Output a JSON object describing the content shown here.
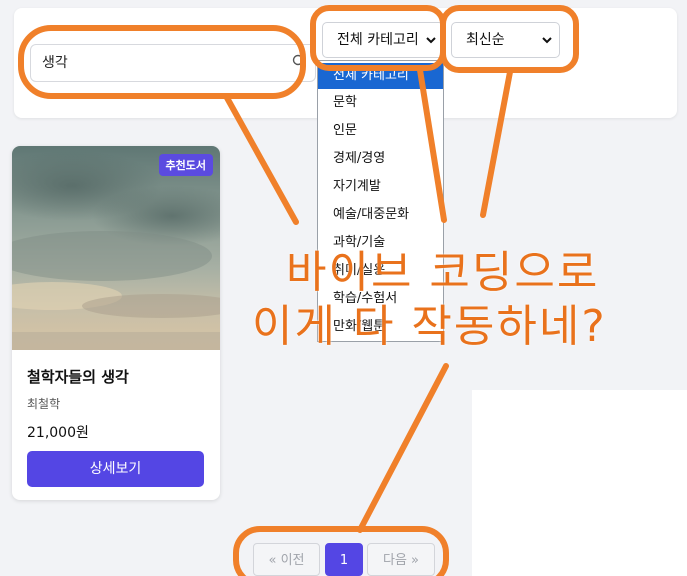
{
  "search": {
    "value": "생각"
  },
  "category_select": {
    "value": "전체 카테고리"
  },
  "sort_select": {
    "value": "최신순"
  },
  "category_options": [
    {
      "label": "전체 카테고리",
      "selected": true
    },
    {
      "label": "문학"
    },
    {
      "label": "인문"
    },
    {
      "label": "경제/경영"
    },
    {
      "label": "자기계발"
    },
    {
      "label": "예술/대중문화"
    },
    {
      "label": "과학/기술"
    },
    {
      "label": "취미/실용"
    },
    {
      "label": "학습/수험서"
    },
    {
      "label": "만화/웹툰"
    }
  ],
  "book": {
    "badge": "추천도서",
    "title": "철학자들의 생각",
    "author": "최철학",
    "price": "21,000원",
    "button": "상세보기"
  },
  "pagination": {
    "prev": "« 이전",
    "page": "1",
    "next": "다음 »"
  },
  "overlay": {
    "line1": "바이브 코딩으로",
    "line2": "이게 다 작동하네?"
  },
  "colors": {
    "accent": "#5446e4",
    "annotation": "#f0802a",
    "dropdown_highlight": "#1967d2"
  }
}
